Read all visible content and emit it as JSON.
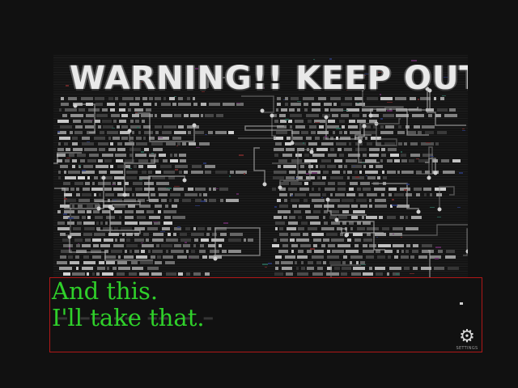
{
  "scene": {
    "sign_title": "WARNING!! KEEP OUT",
    "background_color": "#111111",
    "board_style": "glitched circuit-board and code text image"
  },
  "dialog": {
    "line1": "And this.",
    "line2": "I'll take that.",
    "text_color": "#2fd02a",
    "border_color": "#b01818"
  },
  "controls": {
    "settings_icon": "gear-icon",
    "settings_caption": "SETTINGS"
  }
}
